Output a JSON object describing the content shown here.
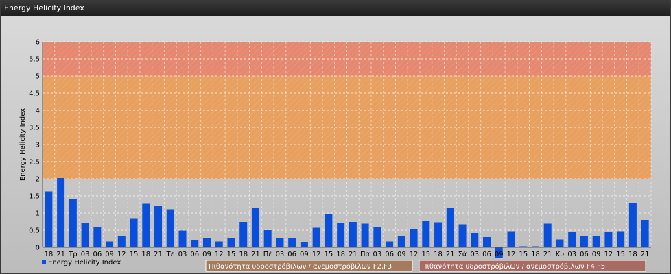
{
  "window": {
    "title": "Energy Helicity Index"
  },
  "chart_data": {
    "type": "bar",
    "title": "",
    "ylabel": "Energy Helicity Index",
    "xlabel": "",
    "ylim": [
      0,
      6
    ],
    "yticks": [
      "0",
      "0.5",
      "1",
      "1.5",
      "2",
      "2.5",
      "3",
      "3.5",
      "4",
      "4.5",
      "5",
      "5.5",
      "6"
    ],
    "grid": true,
    "bar_color": "#0a4fdc",
    "categories": [
      "18",
      "21",
      "Τρ",
      "03",
      "06",
      "09",
      "12",
      "15",
      "18",
      "21",
      "Τε",
      "03",
      "06",
      "09",
      "12",
      "15",
      "18",
      "21",
      "Πέ",
      "03",
      "06",
      "09",
      "12",
      "15",
      "18",
      "21",
      "Πα",
      "03",
      "06",
      "09",
      "12",
      "15",
      "18",
      "21",
      "Σά",
      "03",
      "06",
      "09",
      "12",
      "15",
      "18",
      "21",
      "Κυ",
      "03",
      "06",
      "09",
      "12",
      "15",
      "18",
      "21"
    ],
    "series": [
      {
        "name": "Energy Helicity Index",
        "values": [
          1.63,
          2.02,
          1.4,
          0.72,
          0.6,
          0.17,
          0.34,
          0.85,
          1.27,
          1.2,
          1.11,
          0.49,
          0.22,
          0.27,
          0.17,
          0.26,
          0.74,
          1.15,
          0.5,
          0.28,
          0.26,
          0.14,
          0.57,
          0.98,
          0.71,
          0.74,
          0.69,
          0.59,
          0.17,
          0.33,
          0.53,
          0.76,
          0.73,
          1.14,
          0.67,
          0.42,
          0.3,
          -0.31,
          0.47,
          0.03,
          0.03,
          0.69,
          0.23,
          0.44,
          0.32,
          0.32,
          0.44,
          0.47,
          1.29,
          0.8
        ]
      }
    ],
    "bands": [
      {
        "from": 2,
        "to": 5,
        "color": "#e8a060",
        "label": "Πιθανότητα υδροστρόβιλων / ανεμοστρόβιλων F2,F3",
        "label_color": "#a47b5e"
      },
      {
        "from": 5,
        "to": 6,
        "color": "#e58870",
        "label": "Πιθανότητα υδροστρόβιλων / ανεμοστρόβιλων F4,F5",
        "label_color": "#a86b62"
      }
    ],
    "legend": {
      "position": "bottom-left",
      "entry": "Energy Helicity Index"
    }
  }
}
